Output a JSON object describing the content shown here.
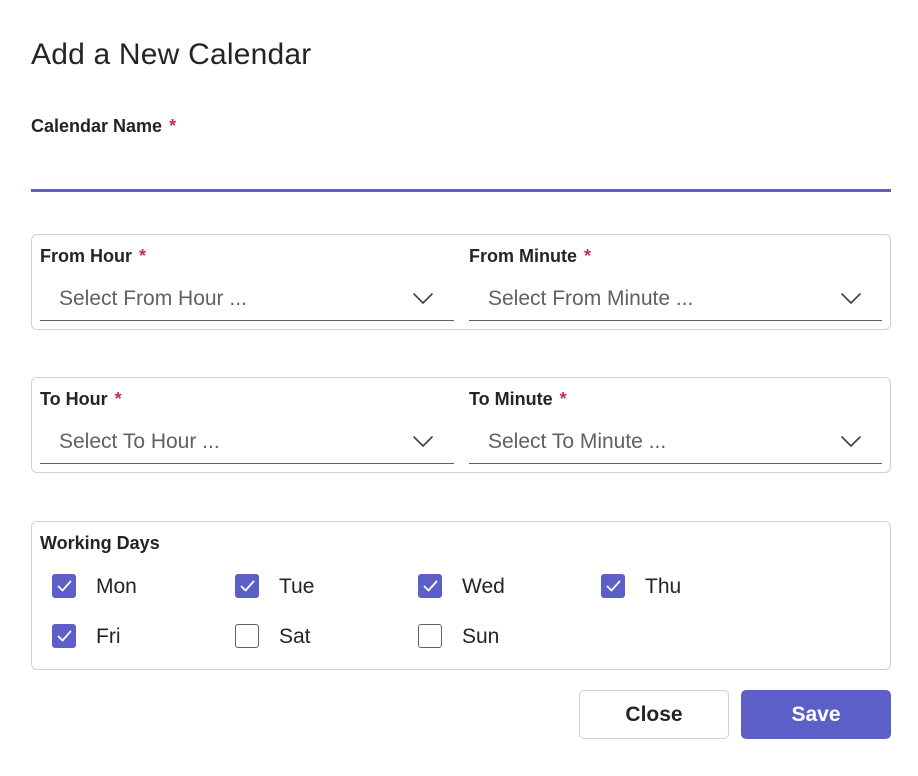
{
  "dialog": {
    "title": "Add a New Calendar"
  },
  "calendar_name": {
    "label": "Calendar Name",
    "required_marker": "*",
    "value": "",
    "placeholder": ""
  },
  "from_hour": {
    "label": "From Hour",
    "required_marker": "*",
    "placeholder": "Select From Hour ..."
  },
  "from_minute": {
    "label": "From Minute",
    "required_marker": "*",
    "placeholder": "Select From Minute ..."
  },
  "to_hour": {
    "label": "To Hour",
    "required_marker": "*",
    "placeholder": "Select To Hour ..."
  },
  "to_minute": {
    "label": "To Minute",
    "required_marker": "*",
    "placeholder": "Select To Minute ..."
  },
  "working_days": {
    "label": "Working Days",
    "days": [
      {
        "label": "Mon",
        "checked": true
      },
      {
        "label": "Tue",
        "checked": true
      },
      {
        "label": "Wed",
        "checked": true
      },
      {
        "label": "Thu",
        "checked": true
      },
      {
        "label": "Fri",
        "checked": true
      },
      {
        "label": "Sat",
        "checked": false
      },
      {
        "label": "Sun",
        "checked": false
      }
    ]
  },
  "buttons": {
    "close_label": "Close",
    "save_label": "Save"
  },
  "colors": {
    "accent": "#5b5fc7",
    "required": "#c4314b",
    "border": "#d1d1d1",
    "text": "#242424",
    "placeholder": "#616161"
  },
  "icons": {
    "dropdown": "chevron-down-icon",
    "checkbox_check": "checkmark-icon"
  }
}
